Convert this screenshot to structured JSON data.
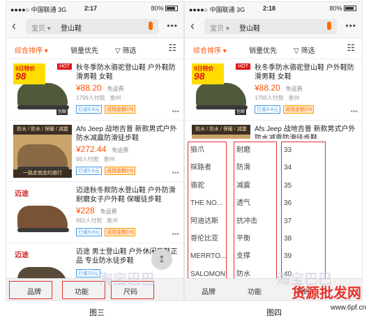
{
  "status": {
    "signal": "●●●●○ 中国联通 3G",
    "battery": "80%"
  },
  "screens": [
    {
      "time": "2:17"
    },
    {
      "time": "2:18"
    }
  ],
  "search": {
    "category": "宝贝 ▾",
    "keyword": "登山鞋",
    "more": "•••"
  },
  "sort": {
    "comprehensive": "综合排序 ▾",
    "sales": "销量优先",
    "filter": "▽ 筛选",
    "view": "☷"
  },
  "items": [
    {
      "title": "秋冬季防水骆驼登山鞋 户外鞋防滑男鞋 女鞋",
      "price": "¥88.20",
      "shipping": "免运费",
      "sold": "1799人付款",
      "location": "泉州",
      "tag1": "已省9.8元",
      "tag2": "返现金额1%",
      "badge_top": "9日特价",
      "badge_num": "98",
      "hot": "HOT",
      "baoyou": "包邮"
    },
    {
      "title": "Afs Jeep 战地吉普 新款男式户外防水减震防滑徒步鞋",
      "price": "¥272.44",
      "shipping": "免运费",
      "sold": "98人付款",
      "location": "泉州",
      "tag1": "已省5.6元",
      "tag2": "返现金额1%",
      "banner_top": "防水 / 防水 / 保暖 / 减震",
      "banner_bottom": "一路走就走的旅行"
    },
    {
      "title": "迈途秋冬款防水登山鞋 户外防滑耐磨女子户外鞋 保暖徒步鞋",
      "price": "¥228",
      "shipping": "免运费",
      "sold": "992人付款",
      "location": "泉州",
      "tag1": "已省9.8元",
      "tag2": "返现金额1%",
      "brand": "迈途"
    },
    {
      "title": "迈途 男士登山鞋 户外休闲男鞋正品 专业防水徒步鞋",
      "price": "",
      "shipping": "",
      "sold": "",
      "location": "",
      "tag1": "已省10元",
      "tag2": "",
      "brand": "迈途"
    }
  ],
  "bottom": {
    "brand": "品牌",
    "function": "功能",
    "size": "尺码"
  },
  "filter_columns": {
    "brands": [
      "狼爪",
      "探路者",
      "骆驼",
      "THE NO...",
      "阿迪达斯",
      "哥伦比亚",
      "MERRTO...",
      "SALOMON"
    ],
    "functions": [
      "耐磨",
      "防滑",
      "减震",
      "透气",
      "抗冲击",
      "平衡",
      "支撑",
      "防水"
    ],
    "sizes": [
      "33",
      "34",
      "35",
      "36",
      "37",
      "38",
      "39",
      "40"
    ]
  },
  "captions": {
    "left": "图三",
    "right": "图四"
  },
  "watermark": {
    "brand": "淘宝巴巴",
    "promo": "货源批发网",
    "site": "www.6pf.cn"
  }
}
